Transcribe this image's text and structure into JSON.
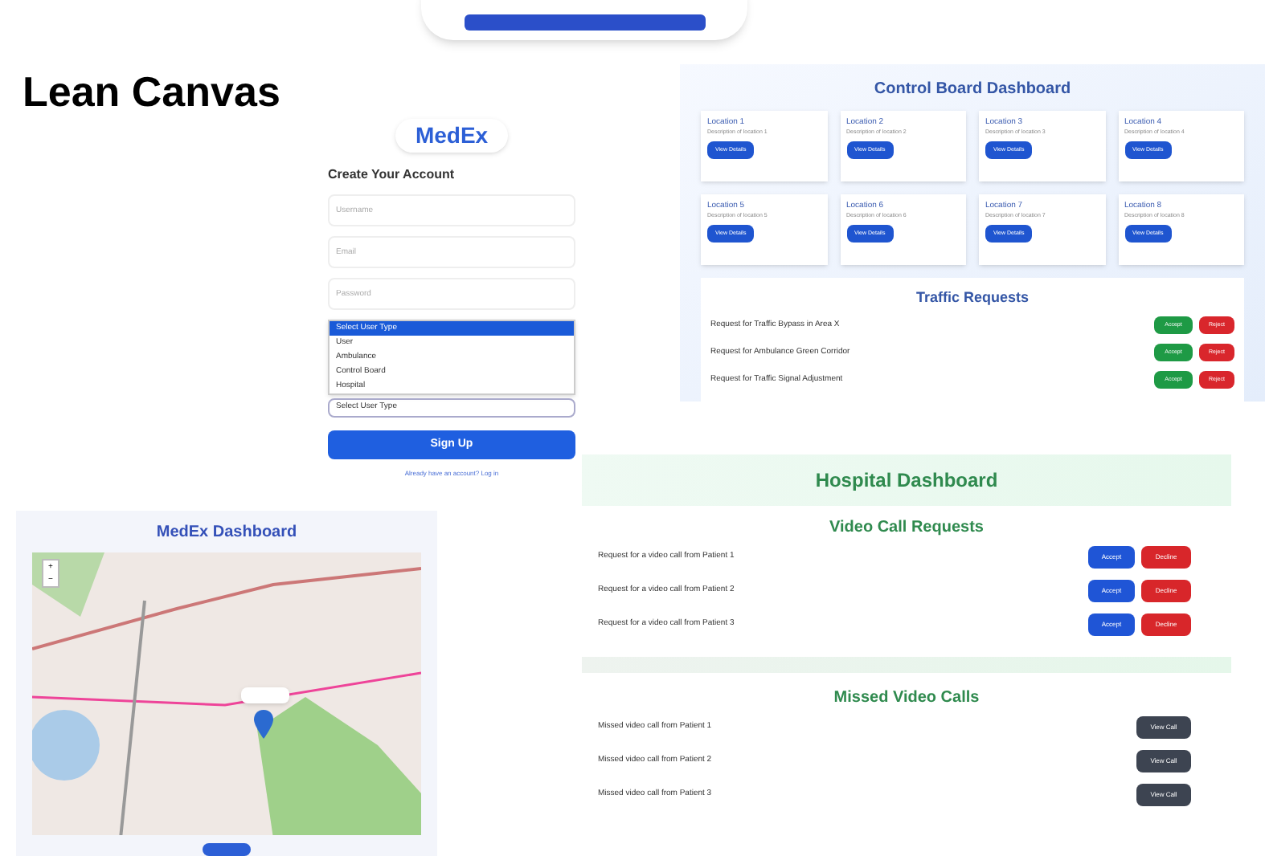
{
  "title": "Lean Canvas",
  "signup": {
    "brand": "MedEx",
    "heading": "Create Your Account",
    "fields": [
      {
        "placeholder": "Username"
      },
      {
        "placeholder": "Email"
      },
      {
        "placeholder": "Password"
      }
    ],
    "dropdown": {
      "options": [
        {
          "label": "Select User Type",
          "selected": true
        },
        {
          "label": "User",
          "selected": false
        },
        {
          "label": "Ambulance",
          "selected": false
        },
        {
          "label": "Control Board",
          "selected": false
        },
        {
          "label": "Hospital",
          "selected": false
        }
      ],
      "value": "Select User Type"
    },
    "button": "Sign Up",
    "link": "Already have an account? Log in"
  },
  "control_board": {
    "title": "Control Board Dashboard",
    "locations": [
      {
        "name": "Location 1",
        "description": "Description of location 1",
        "button": "View Details"
      },
      {
        "name": "Location 2",
        "description": "Description of location 2",
        "button": "View Details"
      },
      {
        "name": "Location 3",
        "description": "Description of location 3",
        "button": "View Details"
      },
      {
        "name": "Location 4",
        "description": "Description of location 4",
        "button": "View Details"
      },
      {
        "name": "Location 5",
        "description": "Description of location 5",
        "button": "View Details"
      },
      {
        "name": "Location 6",
        "description": "Description of location 6",
        "button": "View Details"
      },
      {
        "name": "Location 7",
        "description": "Description of location 7",
        "button": "View Details"
      },
      {
        "name": "Location 8",
        "description": "Description of location 8",
        "button": "View Details"
      }
    ],
    "requests_title": "Traffic Requests",
    "requests": [
      {
        "text": "Request for Traffic Bypass in Area X",
        "accept": "Accept",
        "reject": "Reject"
      },
      {
        "text": "Request for Ambulance Green Corridor",
        "accept": "Accept",
        "reject": "Reject"
      },
      {
        "text": "Request for Traffic Signal Adjustment",
        "accept": "Accept",
        "reject": "Reject"
      }
    ]
  },
  "hospital": {
    "title": "Hospital Dashboard",
    "requests_title": "Video Call Requests",
    "requests": [
      {
        "text": "Request for a video call from Patient 1",
        "accept": "Accept",
        "decline": "Decline"
      },
      {
        "text": "Request for a video call from Patient 2",
        "accept": "Accept",
        "decline": "Decline"
      },
      {
        "text": "Request for a video call from Patient 3",
        "accept": "Accept",
        "decline": "Decline"
      }
    ],
    "missed_title": "Missed Video Calls",
    "missed": [
      {
        "text": "Missed video call from Patient 1",
        "button": "View Call"
      },
      {
        "text": "Missed video call from Patient 2",
        "button": "View Call"
      },
      {
        "text": "Missed video call from Patient 3",
        "button": "View Call"
      }
    ]
  },
  "map_dashboard": {
    "title": "MedEx Dashboard",
    "zoom_in": "+",
    "zoom_out": "−"
  }
}
